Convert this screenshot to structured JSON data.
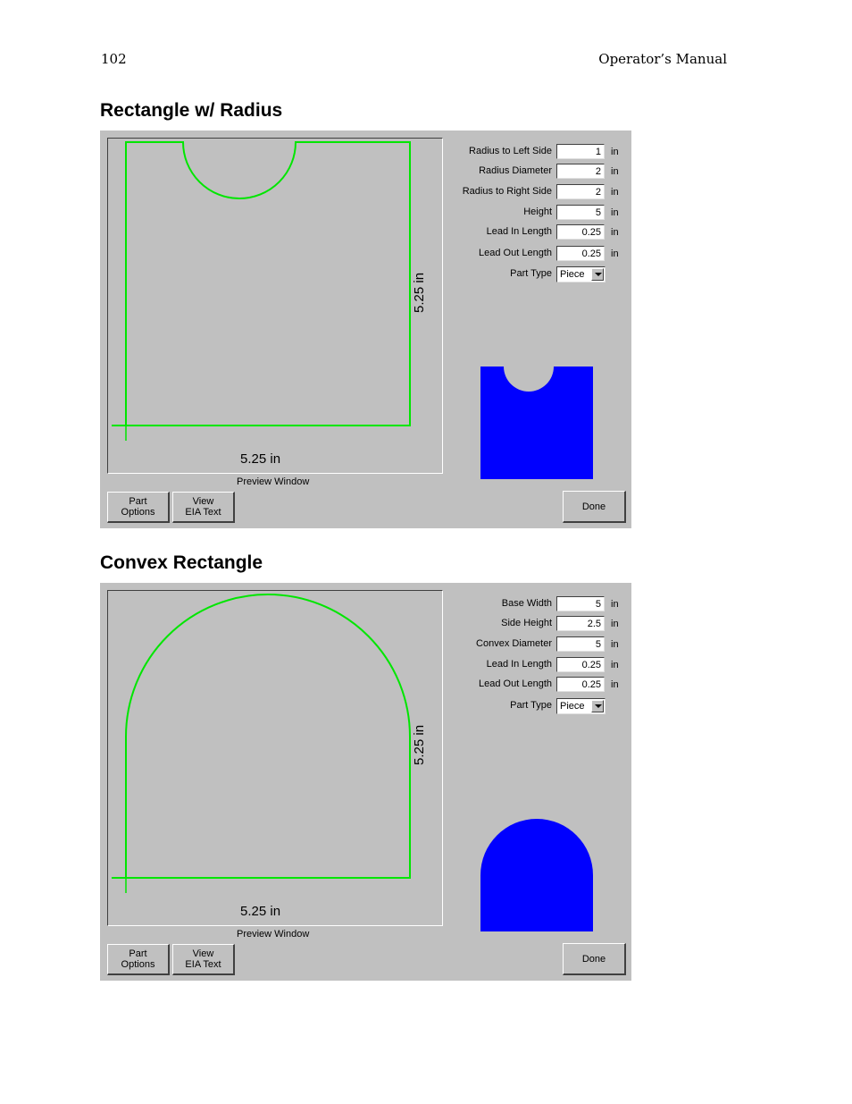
{
  "header": {
    "page_number": "102",
    "manual_title": "Operator’s Manual"
  },
  "sections": [
    {
      "title": "Rectangle w/ Radius",
      "preview": {
        "width_label": "5.25 in",
        "height_label": "5.25 in",
        "label": "Preview Window"
      },
      "fields": [
        {
          "label": "Radius to Left Side",
          "value": "1",
          "unit": "in"
        },
        {
          "label": "Radius Diameter",
          "value": "2",
          "unit": "in"
        },
        {
          "label": "Radius to Right Side",
          "value": "2",
          "unit": "in"
        },
        {
          "label": "Height",
          "value": "5",
          "unit": "in"
        },
        {
          "label": "Lead In Length",
          "value": "0.25",
          "unit": "in"
        },
        {
          "label": "Lead Out Length",
          "value": "0.25",
          "unit": "in"
        }
      ],
      "part_type": {
        "label": "Part Type",
        "value": "Piece"
      },
      "buttons": {
        "part_options_1": "Part",
        "part_options_2": "Options",
        "view_eia_1": "View",
        "view_eia_2": "EIA Text",
        "done": "Done"
      }
    },
    {
      "title": "Convex Rectangle",
      "preview": {
        "width_label": "5.25 in",
        "height_label": "5.25 in",
        "label": "Preview Window"
      },
      "fields": [
        {
          "label": "Base Width",
          "value": "5",
          "unit": "in"
        },
        {
          "label": "Side Height",
          "value": "2.5",
          "unit": "in"
        },
        {
          "label": "Convex Diameter",
          "value": "5",
          "unit": "in"
        },
        {
          "label": "Lead In Length",
          "value": "0.25",
          "unit": "in"
        },
        {
          "label": "Lead Out Length",
          "value": "0.25",
          "unit": "in"
        }
      ],
      "part_type": {
        "label": "Part Type",
        "value": "Piece"
      },
      "buttons": {
        "part_options_1": "Part",
        "part_options_2": "Options",
        "view_eia_1": "View",
        "view_eia_2": "EIA Text",
        "done": "Done"
      }
    }
  ],
  "colors": {
    "panel_bg": "#c0c0c0",
    "toolpath": "#00ff00",
    "part_fill": "#0000ff"
  }
}
